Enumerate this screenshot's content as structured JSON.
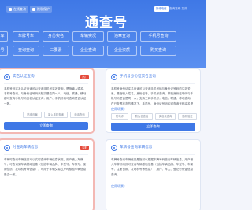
{
  "header": {
    "pill_left": "在线查询",
    "pill_right": "隐私保护",
    "logo": "通查号",
    "badge": "新增电信",
    "tagline": "查询准确 高效"
  },
  "nav": {
    "row1": [
      "车",
      "车牌号车",
      "身份实名",
      "车辆实况",
      "违章查询",
      "手机号查询"
    ],
    "row2": [
      "号",
      "查询查询",
      "二要素",
      "企业查询",
      "企业资质",
      "购买查询"
    ]
  },
  "cards": [
    {
      "title": "实名认证查询",
      "hot": "热门",
      "desc": "手机号码实名认证查询可以查询手机号实名查询，是指输入姓名、手机号查询，与身份证号码来核实是否同一人。电信、联通、移动都可查询手机号码实名认证查询，用户、手机号码可查询是否认证一致。",
      "sub": "",
      "tags": [
        "防电诈骗",
        "新入手机查询",
        "电话查询"
      ],
      "button": "立即查询"
    },
    {
      "title": "手机号身份证实名查询",
      "hot": "",
      "desc": "手机号身份证实名查询可以查询手机号码与身份证号码的实名关系，是指输入姓名、身份证号、手机号查询，核验身份证号码与手机号码是否是同一人，支持三网手机号，电信、联通、移动查询。在已查看状态的情况下，手机号、身份证号码均可查询号码实名是否一致。",
      "sub": "使用场景：",
      "tags": [
        "防电诈",
        "防伪信查验",
        "实名卖查询",
        "随机验证"
      ],
      "button": "立即查询"
    },
    {
      "title": "时查询车辆信息",
      "hot": "实时",
      "desc": "车辆时查询车辆信息可以实时查询车辆信息状况，用户输入车牌号，可查询到车辆基础信息（包括车辆品牌、车型号、车架号、使用性质、发动机号等信息），可用于车辆交易过户时核验车辆信息是否一致。",
      "sub": "",
      "tags": [],
      "button": ""
    },
    {
      "title": "车牌号查询车辆信息",
      "hot": "",
      "desc": "车牌号查询车辆信息是指可以根据车牌号码查询车辆信息，用户输入车牌号码即可查询车辆基础信息（包括车辆品牌、车型号、车架号、注册日期、发动机号等信息），用户、车主、登记行驶证信息查询。",
      "sub": "使用场景：",
      "tags": [],
      "button": ""
    }
  ]
}
